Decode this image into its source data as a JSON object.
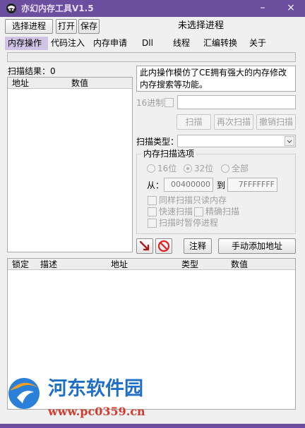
{
  "window": {
    "title": "亦幻内存工具V1.5",
    "minimize_glyph": "–",
    "close_glyph": "×"
  },
  "toolbar": {
    "select_process": "选择进程",
    "open": "打开",
    "save": "保存",
    "status": "未选择进程"
  },
  "tabs": [
    "内存操作",
    "代码注入",
    "内存申请",
    "Dll",
    "线程",
    "汇编转换",
    "关于"
  ],
  "results": {
    "label": "扫描结果：",
    "count": "0",
    "columns": [
      "地址",
      "数值"
    ]
  },
  "scan": {
    "description": "此内操作模仿了CE拥有强大的内存修改内存搜索等功能。",
    "hex_label": "16进制",
    "value_input": "",
    "scan_button": "扫描",
    "rescan_button": "再次扫描",
    "undo_button": "撤销扫描",
    "type_label": "扫描类型：",
    "type_value": "",
    "options_title": "内存扫描选项",
    "bits": {
      "b16": "16位",
      "b32": "32位",
      "all": "全部",
      "selected": "32位"
    },
    "from_label": "从：",
    "from_value": "00400000",
    "to_label": "到",
    "to_value": "7FFFFFFF",
    "readonly_option": "同样扫描只读内存",
    "fast_option": "快速扫描",
    "exact_option": "精确扫描",
    "pause_option": "扫描时暂停进程"
  },
  "actions": {
    "comment": "注释",
    "add_address": "手动添加地址"
  },
  "address_list": {
    "columns": [
      "锁定",
      "描述",
      "地址",
      "类型",
      "数值"
    ]
  },
  "watermark": {
    "name": "河东软件园",
    "url": "www.pc0359.cn"
  },
  "icons": [
    "pointer-arrow-icon",
    "no-entry-icon",
    "chevron-down-icon"
  ],
  "colors": {
    "titlebar": "#6b4e9e",
    "active_tab": "#cfc3e6",
    "watermark_name": "#1f6fc7",
    "watermark_url": "#d33b2c"
  }
}
